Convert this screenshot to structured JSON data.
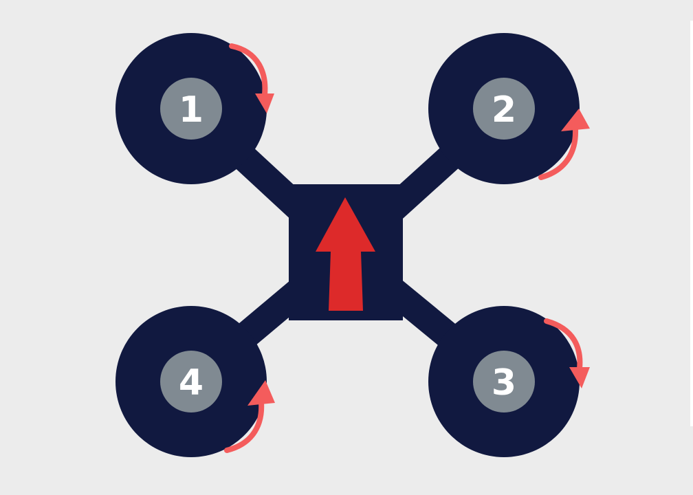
{
  "colors": {
    "background": "#ECECEC",
    "frame": "#111940",
    "hub": "#808A92",
    "label": "#FFFFFF",
    "rotation_arrow": "#F45C5C",
    "heading_arrow": "#DD2A2A"
  },
  "motors": [
    {
      "id": "1",
      "label": "1",
      "position": "top-left",
      "rotation": "clockwise"
    },
    {
      "id": "2",
      "label": "2",
      "position": "top-right",
      "rotation": "counter-clockwise"
    },
    {
      "id": "3",
      "label": "3",
      "position": "bottom-right",
      "rotation": "clockwise"
    },
    {
      "id": "4",
      "label": "4",
      "position": "bottom-left",
      "rotation": "counter-clockwise"
    }
  ],
  "heading": {
    "direction": "up",
    "icon": "forward-arrow-icon"
  }
}
